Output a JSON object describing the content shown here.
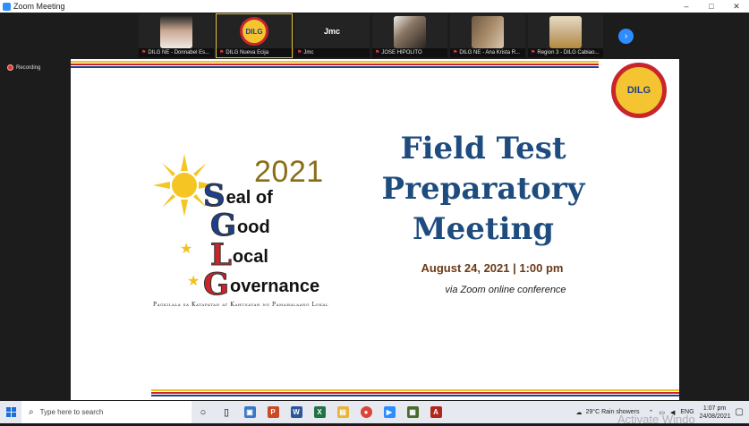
{
  "window": {
    "title": "Zoom Meeting",
    "controls": {
      "minimize": "–",
      "maximize": "□",
      "close": "✕"
    }
  },
  "participants": [
    {
      "caption": "DILG NE - Donnabel Es...",
      "face_color": "#caa892"
    },
    {
      "caption": "DILG Nueva Ecija",
      "logo": "DILG",
      "active": true
    },
    {
      "caption": "Jmc",
      "name": "Jmc"
    },
    {
      "caption": "JOSE HIPOLITO",
      "face_color": "#8a7664"
    },
    {
      "caption": "DILG NE - Ana Krista R...",
      "face_color": "#a88a68"
    },
    {
      "caption": "Region 3 - DILG Cabiao...",
      "face_color": "#c9b089"
    }
  ],
  "recording": {
    "label": "Recording"
  },
  "slide": {
    "logo_text": "DILG",
    "year": "2021",
    "sgl": [
      {
        "cap": "S",
        "rest": "eal of"
      },
      {
        "cap": "G",
        "rest": "ood"
      },
      {
        "cap": "L",
        "rest": "ocal"
      },
      {
        "cap": "G",
        "rest": "overnance"
      }
    ],
    "tagline": "Pagkilala sa Katapatan at Kahusayan ng Pamahalaang Lokal",
    "title_line1": "Field Test",
    "title_line2": "Preparatory",
    "title_line3": "Meeting",
    "date": "August 24, 2021 | 1:00 pm",
    "via": "via Zoom online conference",
    "colors": {
      "title": "#1e4c7e",
      "date": "#6b3a16",
      "year": "#8a6d16"
    }
  },
  "taskbar": {
    "search_placeholder": "Type here to search",
    "apps": [
      "task-view",
      "file-explorer",
      "powerpoint",
      "word",
      "excel",
      "outlook",
      "chrome",
      "zoom",
      "photos",
      "acrobat"
    ],
    "weather": "29°C  Rain showers",
    "language": "ENG",
    "time": "1:07 pm",
    "date": "24/08/2021"
  },
  "watermark": "Activate Windo"
}
